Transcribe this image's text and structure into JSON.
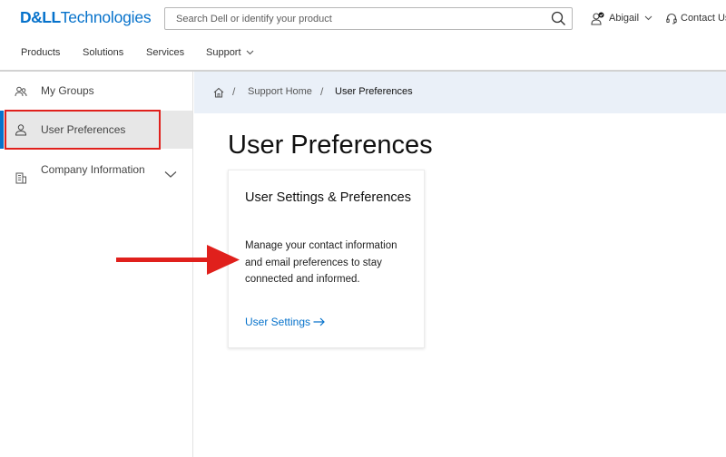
{
  "header": {
    "logo_bold": "D&LL",
    "logo_light": "Technologies",
    "search_placeholder": "Search Dell or identify your product",
    "user_name": "Abigail",
    "contact_label": "Contact Us"
  },
  "nav": {
    "items": [
      "Products",
      "Solutions",
      "Services",
      "Support"
    ]
  },
  "sidebar": {
    "items": [
      {
        "label": "My Groups",
        "icon": "users-icon"
      },
      {
        "label": "User Preferences",
        "icon": "user-icon"
      },
      {
        "label": "Company Information",
        "icon": "building-icon"
      }
    ]
  },
  "breadcrumb": {
    "items": [
      "Support Home",
      "User Preferences"
    ]
  },
  "main": {
    "title": "User Preferences",
    "card": {
      "title": "User Settings & Preferences",
      "description": "Manage your contact information and email preferences to stay connected and informed.",
      "link_label": "User Settings"
    }
  },
  "colors": {
    "brand_blue": "#0672cb",
    "annotation_red": "#e0201c",
    "breadcrumb_bg": "#eaf0f8",
    "selected_bg": "#e7e7e7"
  }
}
